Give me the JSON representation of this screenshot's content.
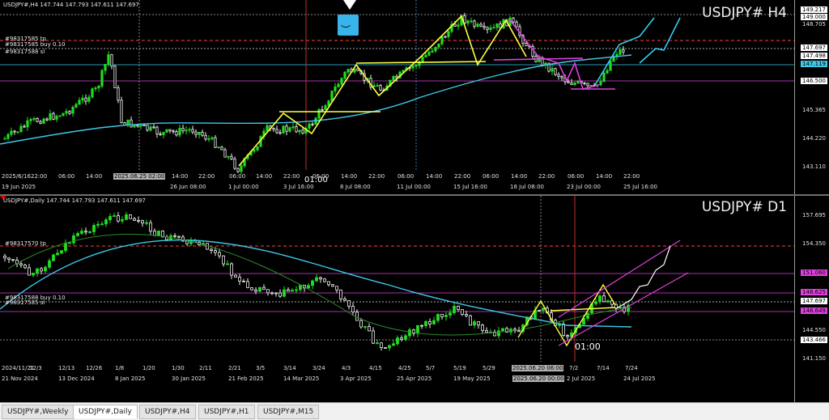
{
  "h4": {
    "header": "USDJPY#,H4  147.744 147.793 147.611 147.697",
    "big_label": "USDJPY# H4",
    "price_labels": [
      "149.217",
      "149.000",
      "148.705",
      "147.697",
      "147.498",
      "147.119",
      "146.500",
      "145.365",
      "144.220",
      "143.110"
    ],
    "time_labels": [
      "2025/6/16",
      "22:00",
      "19 Jun 2025",
      "06:00",
      "14:00",
      "2025.06.25 02:00",
      "26 Jun 08:00",
      "14:00",
      "22:00",
      "1 Jul 00:00",
      "06:00",
      "14:00",
      "22:00",
      "3 Jul 16:00",
      "06:00",
      "8 Jul 08:00",
      "14:00",
      "22:00",
      "11 Jul 00:00",
      "06:00",
      "14:00",
      "15 Jul 16:00",
      "22:00",
      "06:00",
      "18 Jul 08:00",
      "14:00",
      "22:00",
      "23 Jul 00:00",
      "06:00",
      "25 Jul 16:00",
      "14:00",
      "22:00"
    ],
    "order_labels": [
      "#98317585 tp",
      "#98317585 buy 0.10",
      "#98317588 sl"
    ],
    "marker_time": "01:00"
  },
  "d1": {
    "header": "USDJPY#,Daily  147.744 147.793 147.611 147.697",
    "big_label": "USDJPY# D1",
    "price_labels": [
      "157.695",
      "154.350",
      "151.060",
      "148.625",
      "147.697",
      "146.649",
      "144.550",
      "143.466",
      "141.150"
    ],
    "time_labels": [
      "2024/11/21",
      "12/3",
      "12/13",
      "12/26",
      "1/8",
      "1/20",
      "1/30",
      "2/11",
      "2/21",
      "3/5",
      "3/14",
      "3/24",
      "4/3",
      "4/15",
      "4/25",
      "5/7",
      "5/19",
      "5/29",
      "2025.06.20 06:00",
      "7/2",
      "7/14",
      "7/24"
    ],
    "date_labels": [
      "21 Nov 2024",
      "13 Dec 2024",
      "8 Jan 2025",
      "30 Jan 2025",
      "21 Feb 2025",
      "14 Mar 2025",
      "3 Apr 2025",
      "25 Apr 2025",
      "19 May 2025",
      "2025.06.20 00:00",
      "2 Jul 2025",
      "24 Jul 2025"
    ],
    "order_labels": [
      "#98317570 tp",
      "#98317588 buy 0.10",
      "#98317585 sl"
    ],
    "marker_time": "01:00"
  },
  "tabs": [
    "USDJPY#,Weekly",
    "USDJPY#,Daily",
    "USDJPY#,H4",
    "USDJPY#,H1",
    "USDJPY#,M15"
  ],
  "active_tab": "USDJPY#,Daily",
  "colors": {
    "bull": "#22dd22",
    "bear": "#f0f0f0",
    "ma": "#3fc8e8",
    "zigzag": "#ffff40",
    "magenta": "#e040e0",
    "cyan": "#30d0f0",
    "level_red": "#ff4040"
  }
}
